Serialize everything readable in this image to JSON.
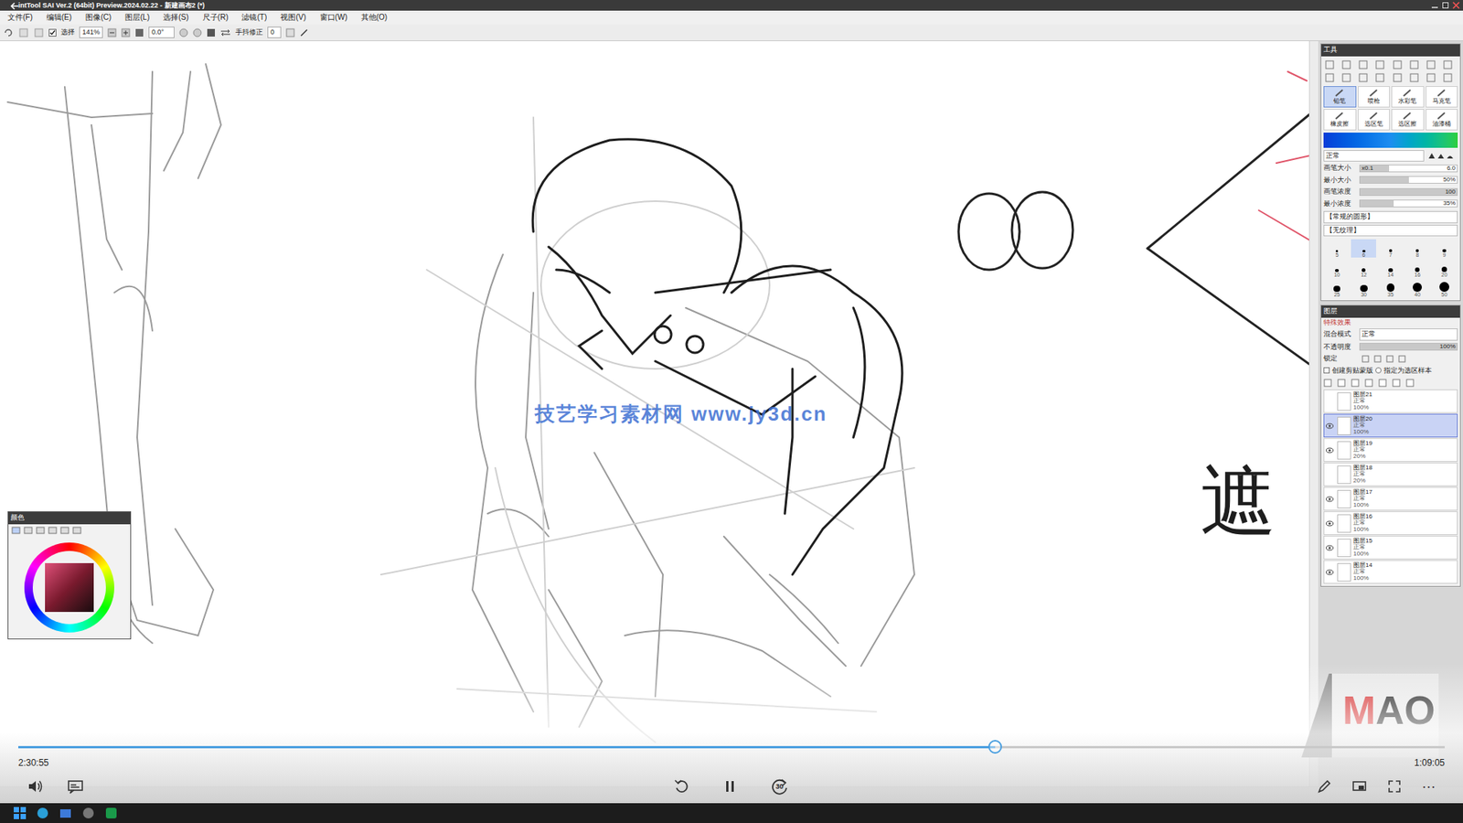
{
  "window": {
    "title": "intTool SAI Ver.2 (64bit) Preview.2024.02.22 - 新建画布2 (*)"
  },
  "menu": [
    "文件(F)",
    "编辑(E)",
    "图像(C)",
    "图层(L)",
    "选择(S)",
    "尺子(R)",
    "滤镜(T)",
    "视图(V)",
    "窗口(W)",
    "其他(O)"
  ],
  "toolbar": {
    "select_label": "选择",
    "select_checked": true,
    "zoom": "141%",
    "angle": "0.0°",
    "stabilizer_label": "手抖修正",
    "stabilizer": "0"
  },
  "canvas": {
    "note": "遮",
    "watermark": "技艺学习素材网 www.jy3d.cn"
  },
  "tools_panel": {
    "title": "工具",
    "brushes": [
      {
        "name": "铅笔",
        "selected": true
      },
      {
        "name": "喷枪",
        "selected": false
      },
      {
        "name": "水彩笔",
        "selected": false
      },
      {
        "name": "马克笔",
        "selected": false
      },
      {
        "name": "橡皮擦",
        "selected": false
      },
      {
        "name": "选区笔",
        "selected": false
      },
      {
        "name": "选区擦",
        "selected": false
      },
      {
        "name": "油漆桶",
        "selected": false
      }
    ],
    "blend": "正常",
    "params": [
      {
        "label": "画笔大小",
        "prefix": "x0.1",
        "value": "6.0",
        "level": 0.3
      },
      {
        "label": "最小大小",
        "prefix": "",
        "value": "50%",
        "level": 0.5
      },
      {
        "label": "画笔浓度",
        "prefix": "",
        "value": "100",
        "level": 1
      },
      {
        "label": "最小浓度",
        "prefix": "",
        "value": "35%",
        "level": 0.35
      }
    ],
    "shape": "【常规的圆形】",
    "texture": "【无纹理】",
    "sizes": [
      {
        "value": "5",
        "selected": false
      },
      {
        "value": "6",
        "selected": true
      },
      {
        "value": "7",
        "selected": false
      },
      {
        "value": "8",
        "selected": false
      },
      {
        "value": "9",
        "selected": false
      },
      {
        "value": "10",
        "selected": false
      },
      {
        "value": "12",
        "selected": false
      },
      {
        "value": "14",
        "selected": false
      },
      {
        "value": "16",
        "selected": false
      },
      {
        "value": "20",
        "selected": false
      },
      {
        "value": "25",
        "selected": false
      },
      {
        "value": "30",
        "selected": false
      },
      {
        "value": "35",
        "selected": false
      },
      {
        "value": "40",
        "selected": false
      },
      {
        "value": "50",
        "selected": false
      }
    ]
  },
  "layers_panel": {
    "title": "图层",
    "effects": "特殊效果",
    "blend_label": "混合模式",
    "blend": "正常",
    "opacity_label": "不透明度",
    "opacity": "100%",
    "opacity_level": 1,
    "lock_label": "锁定",
    "clip": "创建剪贴蒙版",
    "sample": "指定为选区样本",
    "layers": [
      {
        "name": "图层21",
        "mode": "正常",
        "opacity": "100%",
        "visible": false,
        "selected": false
      },
      {
        "name": "图层20",
        "mode": "正常",
        "opacity": "100%",
        "visible": true,
        "selected": true
      },
      {
        "name": "图层19",
        "mode": "正常",
        "opacity": "20%",
        "visible": true,
        "selected": false
      },
      {
        "name": "图层18",
        "mode": "正常",
        "opacity": "20%",
        "visible": false,
        "selected": false
      },
      {
        "name": "图层17",
        "mode": "正常",
        "opacity": "100%",
        "visible": true,
        "selected": false
      },
      {
        "name": "图层16",
        "mode": "正常",
        "opacity": "100%",
        "visible": true,
        "selected": false
      },
      {
        "name": "图层15",
        "mode": "正常",
        "opacity": "100%",
        "visible": true,
        "selected": false
      },
      {
        "name": "图层14",
        "mode": "正常",
        "opacity": "100%",
        "visible": true,
        "selected": false
      }
    ]
  },
  "color_panel": {
    "title": "颜色"
  },
  "logo": "MAO",
  "player": {
    "elapsed": "2:30:55",
    "total": "1:09:05",
    "level": 0.685,
    "skip_forward": "30",
    "playing": true,
    "more": "⋯"
  }
}
